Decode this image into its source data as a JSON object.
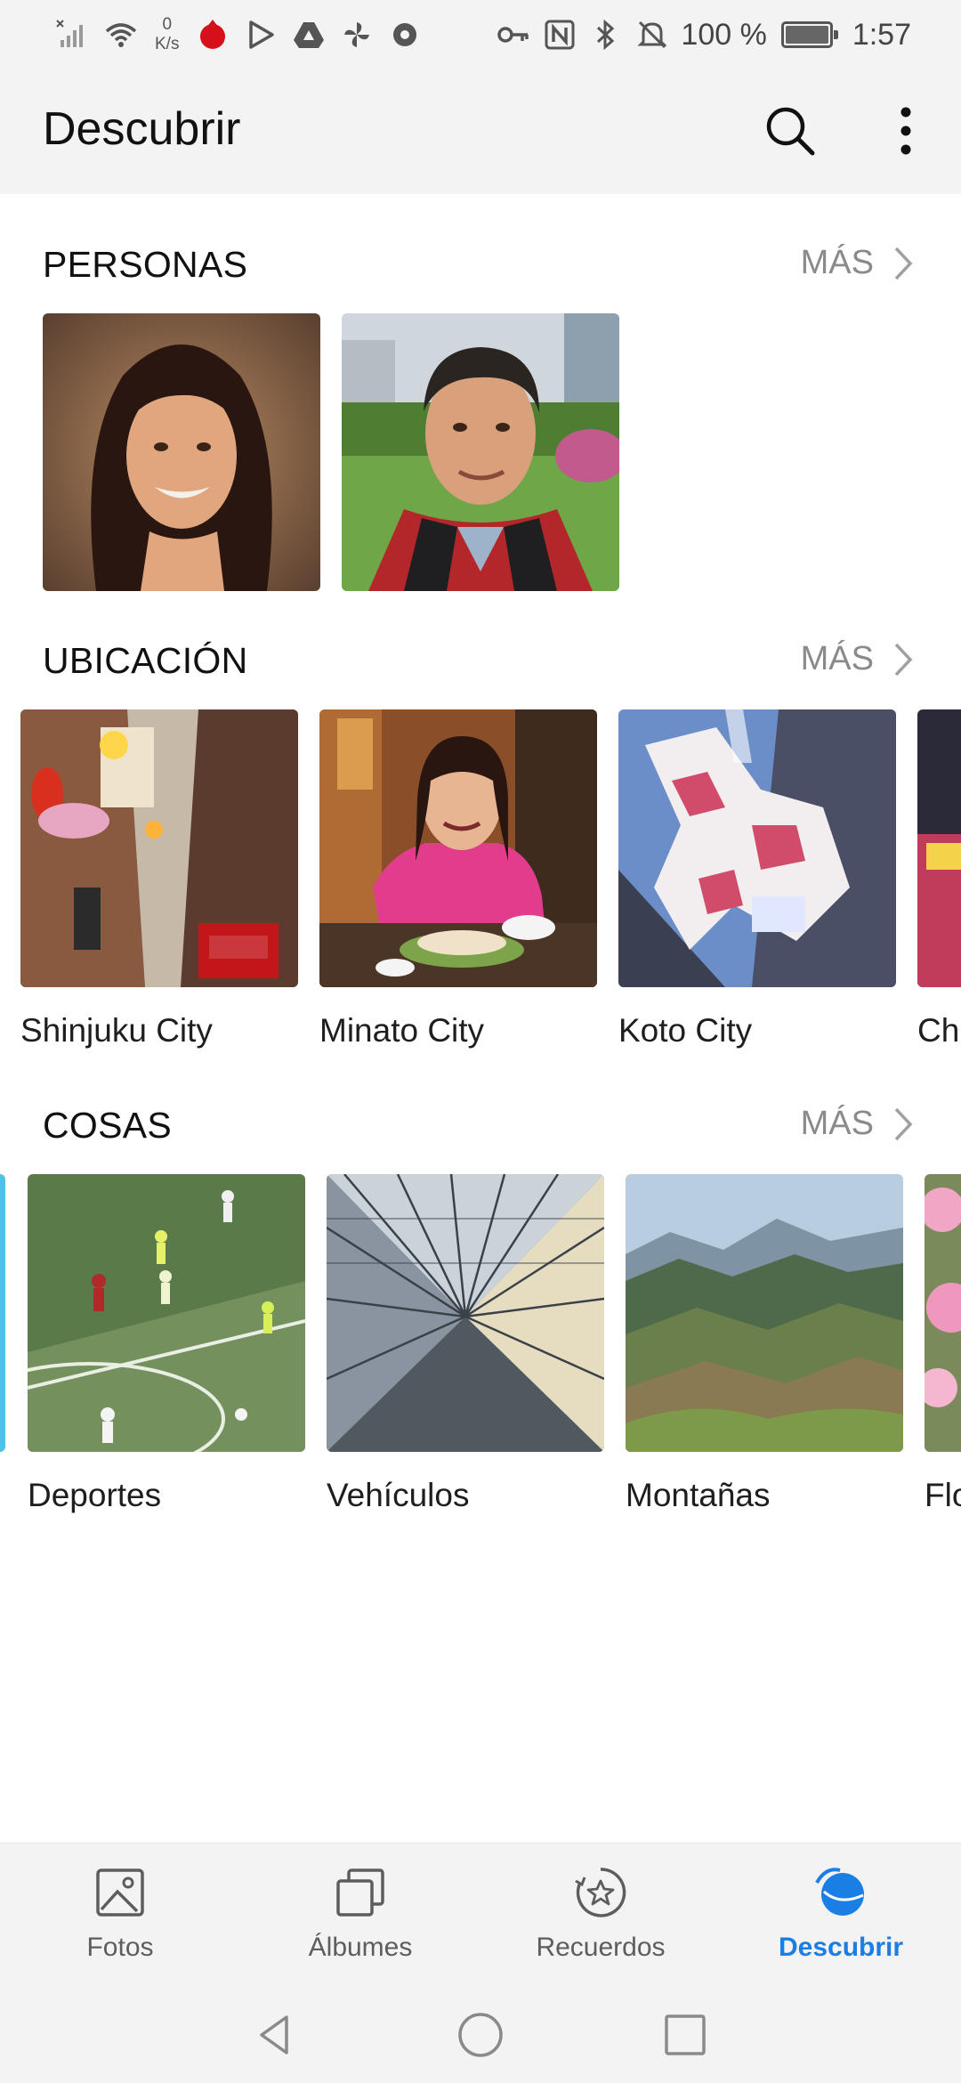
{
  "status_bar": {
    "net_speed_value": "0",
    "net_speed_unit": "K/s",
    "battery": "100 %",
    "battery_level": 1.0,
    "time": "1:57"
  },
  "header": {
    "title": "Descubrir",
    "search_icon": "search-icon",
    "more_icon": "more-vertical-icon"
  },
  "sections": {
    "people": {
      "title": "PERSONAS",
      "more_label": "MÁS"
    },
    "location": {
      "title": "UBICACIÓN",
      "more_label": "MÁS",
      "items": [
        {
          "label": "Shinjuku City"
        },
        {
          "label": "Minato City"
        },
        {
          "label": "Koto City"
        },
        {
          "label": "Ch"
        }
      ]
    },
    "things": {
      "title": "COSAS",
      "more_label": "MÁS",
      "items": [
        {
          "label": "Deportes"
        },
        {
          "label": "Vehículos"
        },
        {
          "label": "Montañas"
        },
        {
          "label": "Flo"
        }
      ]
    }
  },
  "bottom_nav": {
    "items": [
      {
        "label": "Fotos",
        "icon": "photo-icon"
      },
      {
        "label": "Álbumes",
        "icon": "albums-icon"
      },
      {
        "label": "Recuerdos",
        "icon": "memories-icon"
      },
      {
        "label": "Descubrir",
        "icon": "discover-icon",
        "active": true
      }
    ]
  },
  "colors": {
    "accent": "#1a7fe5",
    "bar_background": "#f3f3f3",
    "secondary_text": "#8a8a8a"
  }
}
